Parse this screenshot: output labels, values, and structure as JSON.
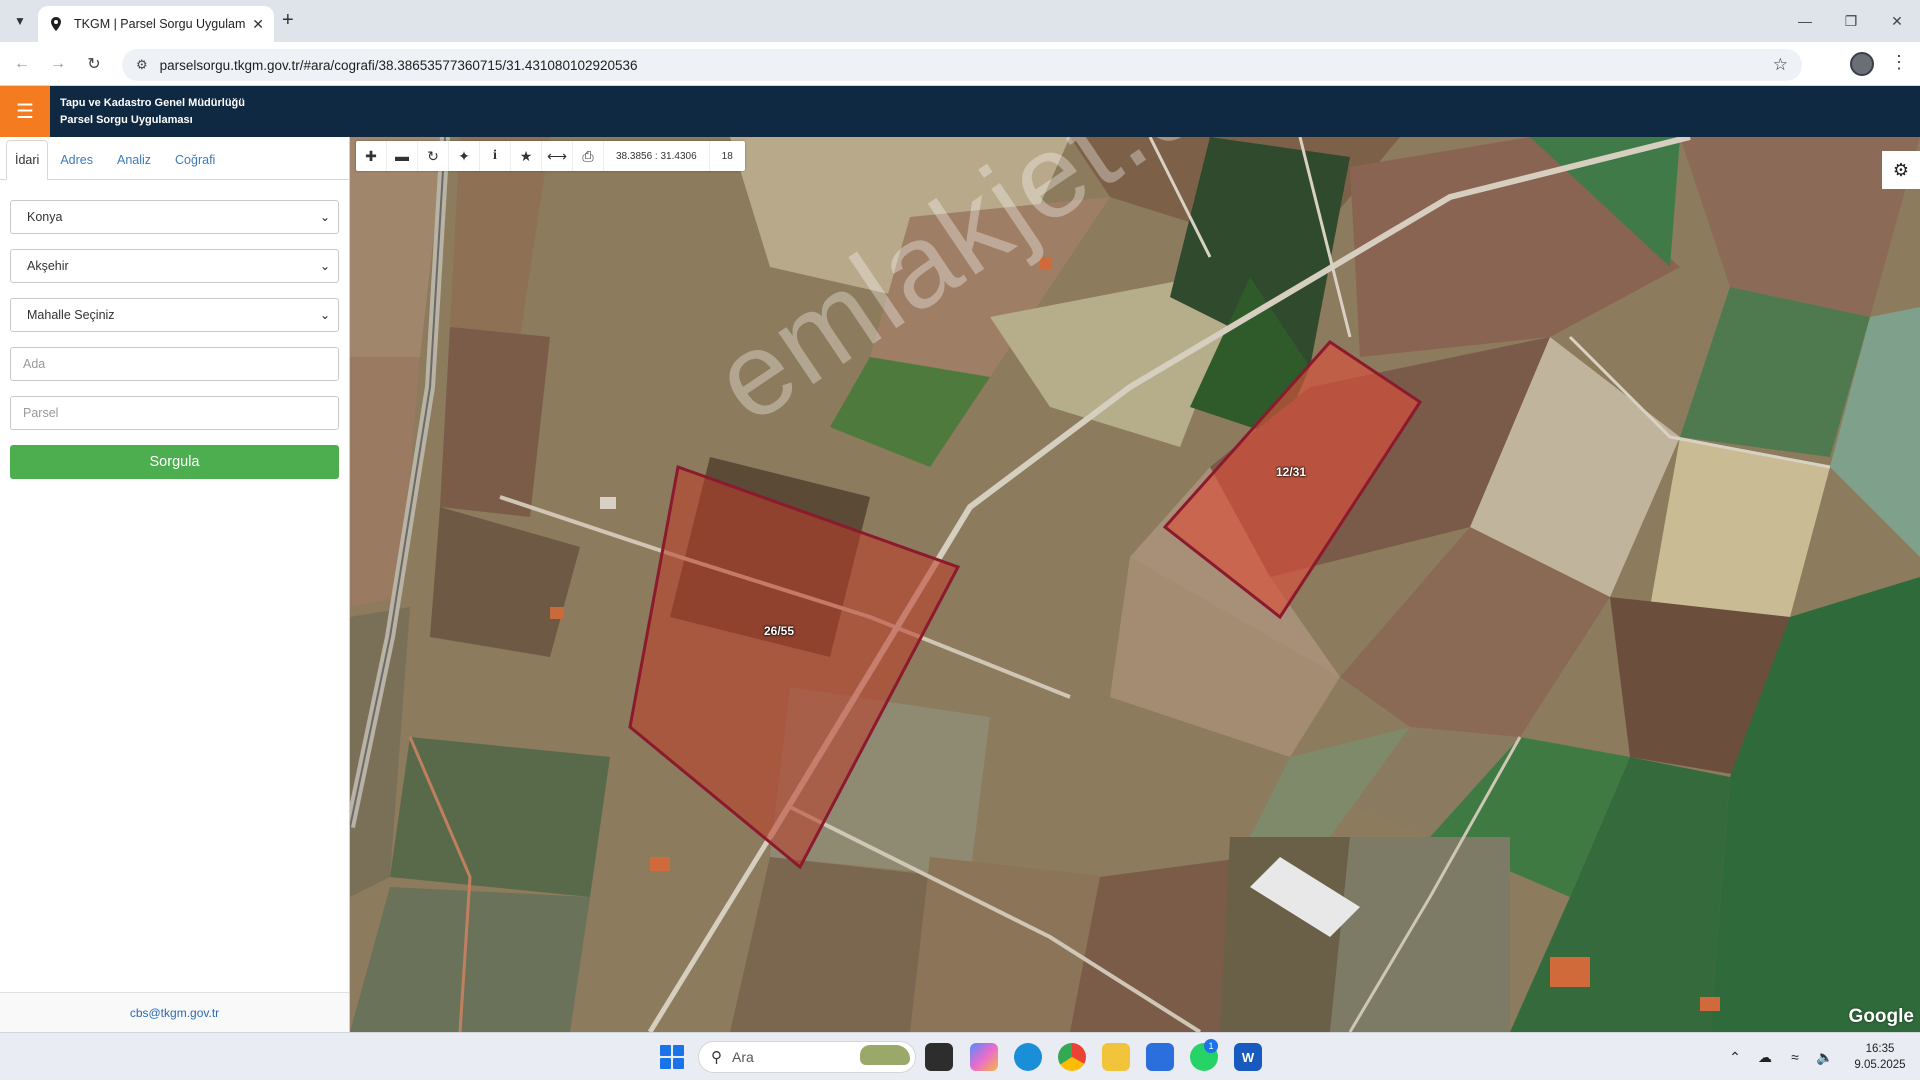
{
  "browser": {
    "tab_title": "TKGM | Parsel Sorgu Uygulaması",
    "url": "parselsorgu.tkgm.gov.tr/#ara/cografi/38.38653577360715/31.431080102920536"
  },
  "app": {
    "title_line1": "Tapu ve Kadastro Genel Müdürlüğü",
    "title_line2": "Parsel Sorgu Uygulaması",
    "accent_color": "#f47b20",
    "header_color": "#0f2942"
  },
  "sidebar": {
    "tabs": [
      "İdari",
      "Adres",
      "Analiz",
      "Coğrafi"
    ],
    "active_tab": "İdari",
    "province": "Konya",
    "district": "Akşehir",
    "neighborhood": "Mahalle Seçiniz",
    "ada_placeholder": "Ada",
    "parsel_placeholder": "Parsel",
    "submit_label": "Sorgula",
    "footer_email": "cbs@tkgm.gov.tr"
  },
  "map": {
    "coordinates": "38.3856 : 31.4306",
    "zoom_level": "18",
    "parcel_labels": [
      "26/55",
      "12/31"
    ],
    "watermark": "emlakjet.com",
    "attribution": "Google",
    "toolbar_icons": [
      "zoom-in-icon",
      "zoom-out-icon",
      "refresh-icon",
      "crosshair-icon",
      "info-icon",
      "star-icon",
      "measure-icon",
      "print-icon"
    ]
  },
  "taskbar": {
    "search_placeholder": "Ara",
    "time": "16:35",
    "date": "9.05.2025",
    "whatsapp_badge": "1"
  }
}
